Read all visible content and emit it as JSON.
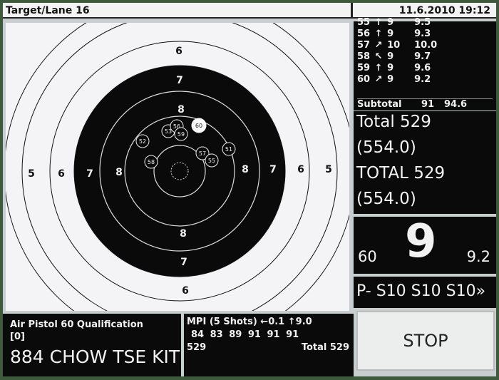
{
  "title_bar": {
    "title": "Target/Lane 16",
    "datetime": "11.6.2010 19:12"
  },
  "target": {
    "ring_labels": [
      {
        "ring": 5,
        "label": "5"
      },
      {
        "ring": 6,
        "label": "6"
      },
      {
        "ring": 7,
        "label": "7"
      },
      {
        "ring": 8,
        "label": "8"
      }
    ],
    "shots": [
      {
        "label": "51"
      },
      {
        "label": "52"
      },
      {
        "label": "53"
      },
      {
        "label": "56"
      },
      {
        "label": "57"
      },
      {
        "label": "55"
      },
      {
        "label": "58"
      },
      {
        "label": "59"
      },
      {
        "label": "60"
      }
    ],
    "colors": {
      "black_area": "#0a0a0a",
      "paper": "#f4f4f6",
      "last_shot": "#ffffff"
    }
  },
  "shot_list": {
    "rows": [
      {
        "n": "55",
        "dir": "↑",
        "score": "9",
        "decimal": "9.5",
        "cut": true
      },
      {
        "n": "56",
        "dir": "↑",
        "score": "9",
        "decimal": "9.3"
      },
      {
        "n": "57",
        "dir": "↗",
        "score": "10",
        "decimal": "10.0"
      },
      {
        "n": "58",
        "dir": "↖",
        "score": "9",
        "decimal": "9.7"
      },
      {
        "n": "59",
        "dir": "↑",
        "score": "9",
        "decimal": "9.6"
      },
      {
        "n": "60",
        "dir": "↗",
        "score": "9",
        "decimal": "9.2"
      }
    ],
    "subtotal_label": "Subtotal",
    "subtotal_score": "91",
    "subtotal_decimal": "94.6"
  },
  "totals": {
    "line1": "Total  529",
    "line2": "(554.0)",
    "line3": "TOTAL 529",
    "line4": "(554.0)"
  },
  "last_shot": {
    "number": "60",
    "score": "9",
    "decimal": "9.2"
  },
  "sighters": {
    "text": "P- S10 S10 S10»"
  },
  "event": {
    "name": "Air Pistol 60 Qualification",
    "relay": "[0]",
    "shooter": "884 CHOW TSE KIT"
  },
  "mpi": {
    "header": "MPI (5 Shots) ←0.1  ↑9.0",
    "series": "84  83  89  91  91  91",
    "cumulative": "529",
    "total": "Total 529"
  },
  "stop_button": {
    "label": "STOP"
  }
}
